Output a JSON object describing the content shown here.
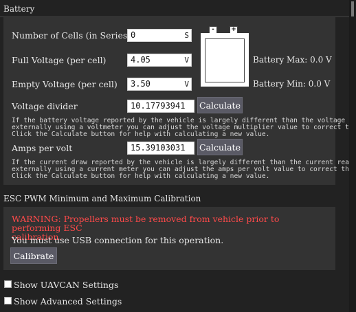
{
  "battery": {
    "section_title": "Battery",
    "cells": {
      "label": "Number of Cells (in Series)",
      "value": "0",
      "unit": "S"
    },
    "full_voltage": {
      "label": "Full Voltage (per cell)",
      "value": "4.05",
      "unit": "V"
    },
    "empty_voltage": {
      "label": "Empty Voltage (per cell)",
      "value": "3.50",
      "unit": "V"
    },
    "battery_max": "Battery Max: 0.0 V",
    "battery_min": "Battery Min: 0.0 V",
    "terminal_minus": "-",
    "terminal_plus": "+",
    "voltage_divider": {
      "label": "Voltage divider",
      "value": "10.17793941",
      "button": "Calculate",
      "help": [
        "If the battery voltage reported by the vehicle is largely different than the voltage read",
        "externally using a voltmeter you can adjust the voltage multiplier value to correct this.",
        "Click the Calculate button for help with calculating a new value."
      ]
    },
    "amps_per_volt": {
      "label": "Amps per volt",
      "value": "15.39103031",
      "button": "Calculate",
      "help": [
        "If the current draw reported by the vehicle is largely different than the current read",
        "externally using a current meter you can adjust the amps per volt value to correct this.",
        "Click the Calculate button for help with calculating a new value."
      ]
    }
  },
  "esc": {
    "section_title": "ESC PWM Minimum and Maximum Calibration",
    "warning_line1": "WARNING: Propellers must be removed from vehicle prior to performing ESC",
    "warning_line2": "calibration.",
    "usb_note": "You must use USB connection for this operation.",
    "calibrate_button": "Calibrate"
  },
  "options": {
    "uavcan": {
      "label": "Show UAVCAN Settings",
      "checked": false
    },
    "advanced": {
      "label": "Show Advanced Settings",
      "checked": false
    }
  },
  "colors": {
    "background": "#222222",
    "panel": "#333333",
    "warning": "#ff4a4a",
    "button": "#5a5a65"
  }
}
